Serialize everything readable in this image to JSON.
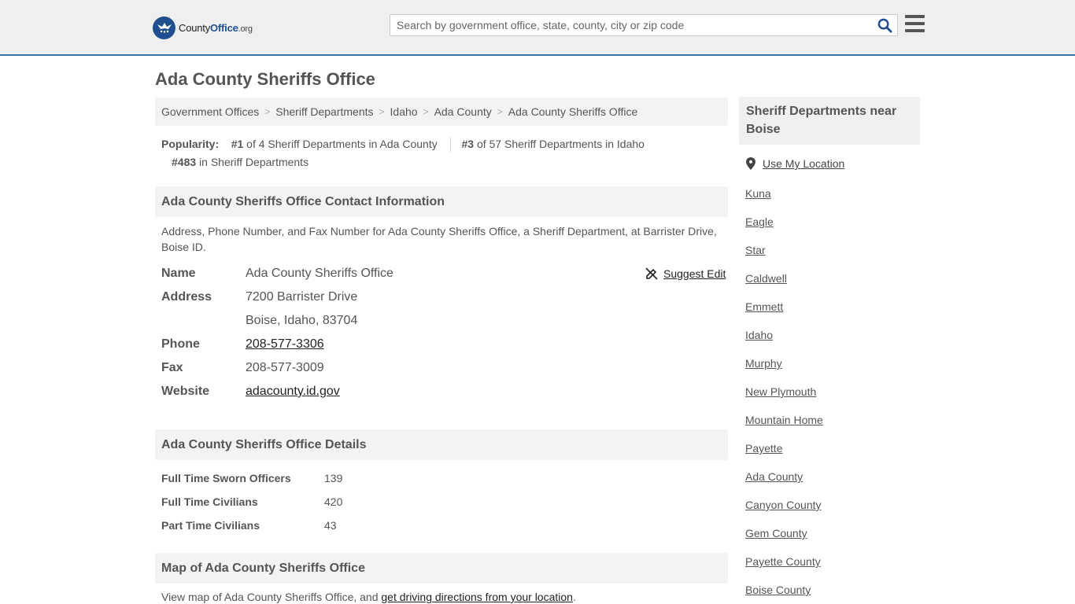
{
  "header": {
    "logo_prefix": "County",
    "logo_accent": "Office",
    "logo_tld": ".org",
    "search_placeholder": "Search by government office, state, county, city or zip code"
  },
  "page": {
    "title": "Ada County Sheriffs Office"
  },
  "breadcrumb": [
    "Government Offices",
    "Sheriff Departments",
    "Idaho",
    "Ada County",
    "Ada County Sheriffs Office"
  ],
  "popularity": {
    "label": "Popularity:",
    "rank1": "#1",
    "rank1_text": "of 4 Sheriff Departments in Ada County",
    "rank2": "#3",
    "rank2_text": "of 57 Sheriff Departments in Idaho",
    "rank3": "#483",
    "rank3_text": "in Sheriff Departments"
  },
  "contact": {
    "heading": "Ada County Sheriffs Office Contact Information",
    "description": "Address, Phone Number, and Fax Number for Ada County Sheriffs Office, a Sheriff Department, at Barrister Drive, Boise ID.",
    "suggest_edit": "Suggest Edit",
    "name_label": "Name",
    "name_value": "Ada County Sheriffs Office",
    "address_label": "Address",
    "address_line1": "7200 Barrister Drive",
    "address_line2": "Boise, Idaho, 83704",
    "phone_label": "Phone",
    "phone_value": "208-577-3306",
    "fax_label": "Fax",
    "fax_value": "208-577-3009",
    "website_label": "Website",
    "website_value": "adacounty.id.gov"
  },
  "details": {
    "heading": "Ada County Sheriffs Office Details",
    "rows": [
      {
        "label": "Full Time Sworn Officers",
        "value": "139"
      },
      {
        "label": "Full Time Civilians",
        "value": "420"
      },
      {
        "label": "Part Time Civilians",
        "value": "43"
      }
    ]
  },
  "map": {
    "heading": "Map of Ada County Sheriffs Office",
    "desc_prefix": "View map of Ada County Sheriffs Office, and",
    "desc_link": "get driving directions from your location",
    "desc_suffix": "."
  },
  "sidebar": {
    "heading": "Sheriff Departments near Boise",
    "use_location": "Use My Location",
    "links": [
      "Kuna",
      "Eagle",
      "Star",
      "Caldwell",
      "Emmett",
      "Idaho",
      "Murphy",
      "New Plymouth",
      "Mountain Home",
      "Payette",
      "Ada County",
      "Canyon County",
      "Gem County",
      "Payette County",
      "Boise County"
    ]
  },
  "colors": {
    "brand_blue": "#1f4f8f",
    "header_border": "#3a6fb0",
    "panel_gray": "#f3f3f3"
  }
}
